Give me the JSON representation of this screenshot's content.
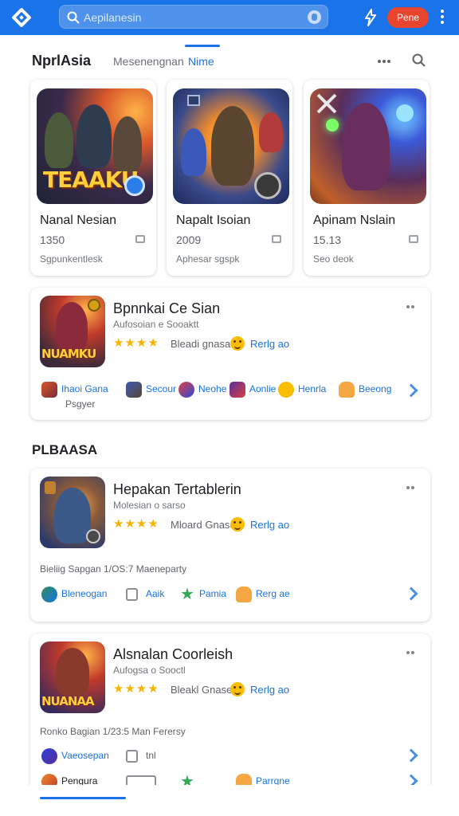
{
  "search": {
    "value": "Aepilanesin"
  },
  "header": {
    "profile_label": "Pene",
    "brand": "NprlAsia",
    "tabs": [
      "Mesenengnan",
      "Nime"
    ]
  },
  "featured": [
    {
      "title": "Nanal Nesian",
      "number": "1350",
      "subtitle": "Sgpunkentlesk",
      "art_text": "TEAAKU"
    },
    {
      "title": "Napalt Isoian",
      "number": "2009",
      "subtitle": "Aphesar sgspk",
      "art_text": ""
    },
    {
      "title": "Apinam Nslain",
      "number": "15.13",
      "subtitle": "Seo deok",
      "art_text": ""
    }
  ],
  "card1": {
    "title": "Bpnnkai Ce Sian",
    "subtitle": "Aufosoian e Sooaktt",
    "stars": "★★★★",
    "rating_label": "Bleadi gnasa",
    "reply": "Rerlg ao",
    "chips": [
      "Ihaoi Gana",
      "Secour",
      "Neohe",
      "Aonlie",
      "Henrla",
      "Beeong"
    ],
    "chip_sub": "Psgyer",
    "art_text": "NUAMKU"
  },
  "section_title": "PLBAASA",
  "card2": {
    "title": "Hepakan Tertablerin",
    "subtitle": "Molesian o sarso",
    "stars": "★★★★",
    "rating_label": "Mloard Gnaso",
    "reply": "Rerlg ao",
    "meta": "Bieliig Sapgan 1/OS:7 Maeneparty",
    "chips": [
      "Bleneogan",
      "Aaik",
      "Pamia",
      "Rerg ae"
    ]
  },
  "card3": {
    "title": "Alsnalan Coorleish",
    "subtitle": "Aufogsa o Sooctl",
    "stars": "★★★★",
    "rating_label": "Bleakl Gnase",
    "reply": "Rerlg ao",
    "meta": "Ronko Bagian 1/23:5 Man Ferersy",
    "chips_row1": [
      "Vaeosepan",
      "tnl"
    ],
    "chips_row2": [
      "Pengura",
      "",
      "",
      "Parrqne"
    ],
    "art_text": "NUANAA"
  },
  "colors": {
    "brand_blue": "#1a73e8",
    "profile_red": "#e8452f",
    "star": "#f5b400"
  }
}
